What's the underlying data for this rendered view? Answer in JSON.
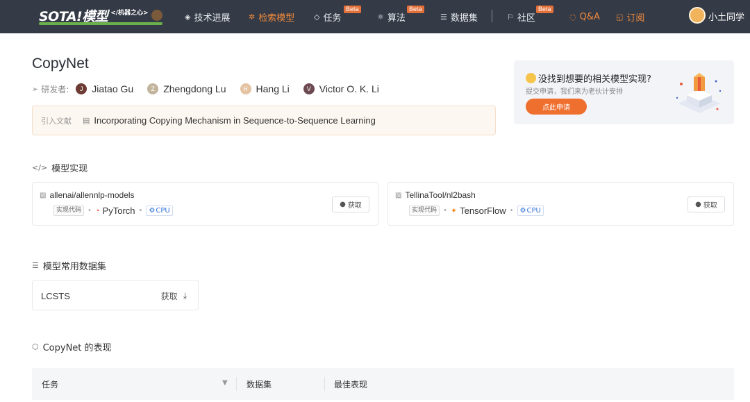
{
  "nav": {
    "logo_text": "SOTA!模型",
    "logo_sub": "</机器之心>",
    "items": [
      {
        "label": "技术进展",
        "icon": "tech-icon"
      },
      {
        "label": "检索模型",
        "icon": "search-model-icon"
      },
      {
        "label": "任务",
        "icon": "layers-icon",
        "badge": "Beta"
      },
      {
        "label": "算法",
        "icon": "algorithm-icon",
        "badge": "Beta"
      },
      {
        "label": "数据集",
        "icon": "database-icon"
      },
      {
        "label": "社区",
        "icon": "flag-icon",
        "badge": "Beta"
      },
      {
        "label": "Q&A",
        "icon": "qa-icon"
      },
      {
        "label": "订阅",
        "icon": "subscribe-icon"
      }
    ],
    "user_name": "小土同学"
  },
  "model": {
    "title": "CopyNet",
    "authors_label": "研发者:",
    "authors": [
      {
        "initial": "J",
        "name": "Jiatao Gu",
        "color": "#6b3b34"
      },
      {
        "initial": "Z",
        "name": "Zhengdong Lu",
        "color": "#c2b49c"
      },
      {
        "initial": "H",
        "name": "Hang Li",
        "color": "#e5c3a1"
      },
      {
        "initial": "V",
        "name": "Victor O. K. Li",
        "color": "#6d4a51"
      }
    ],
    "citation_label": "引入文献",
    "citation": "Incorporating Copying Mechanism in Sequence-to-Sequence Learning"
  },
  "promo": {
    "title": "没找到想要的相关模型实现?",
    "subtitle": "提交申请，我们来为老伙计安排",
    "button": "点此申请"
  },
  "implementations": {
    "section_title": "模型实现",
    "items": [
      {
        "repo": "allenai/allennlp-models",
        "tag": "实现代码",
        "framework": "PyTorch",
        "device": "CPU",
        "button": "获取"
      },
      {
        "repo": "TellinaTool/nl2bash",
        "tag": "实现代码",
        "framework": "TensorFlow",
        "device": "CPU",
        "button": "获取"
      }
    ]
  },
  "datasets": {
    "section_title": "模型常用数据集",
    "items": [
      {
        "name": "LCSTS",
        "action": "获取"
      }
    ]
  },
  "performance": {
    "section_title": "CopyNet 的表现",
    "columns": [
      "任务",
      "数据集",
      "最佳表现"
    ]
  },
  "colors": {
    "nav_bg": "#343a46",
    "accent": "#f08a3c",
    "promo_button": "#ef6f2f",
    "cpu_blue": "#2e6fd8"
  }
}
